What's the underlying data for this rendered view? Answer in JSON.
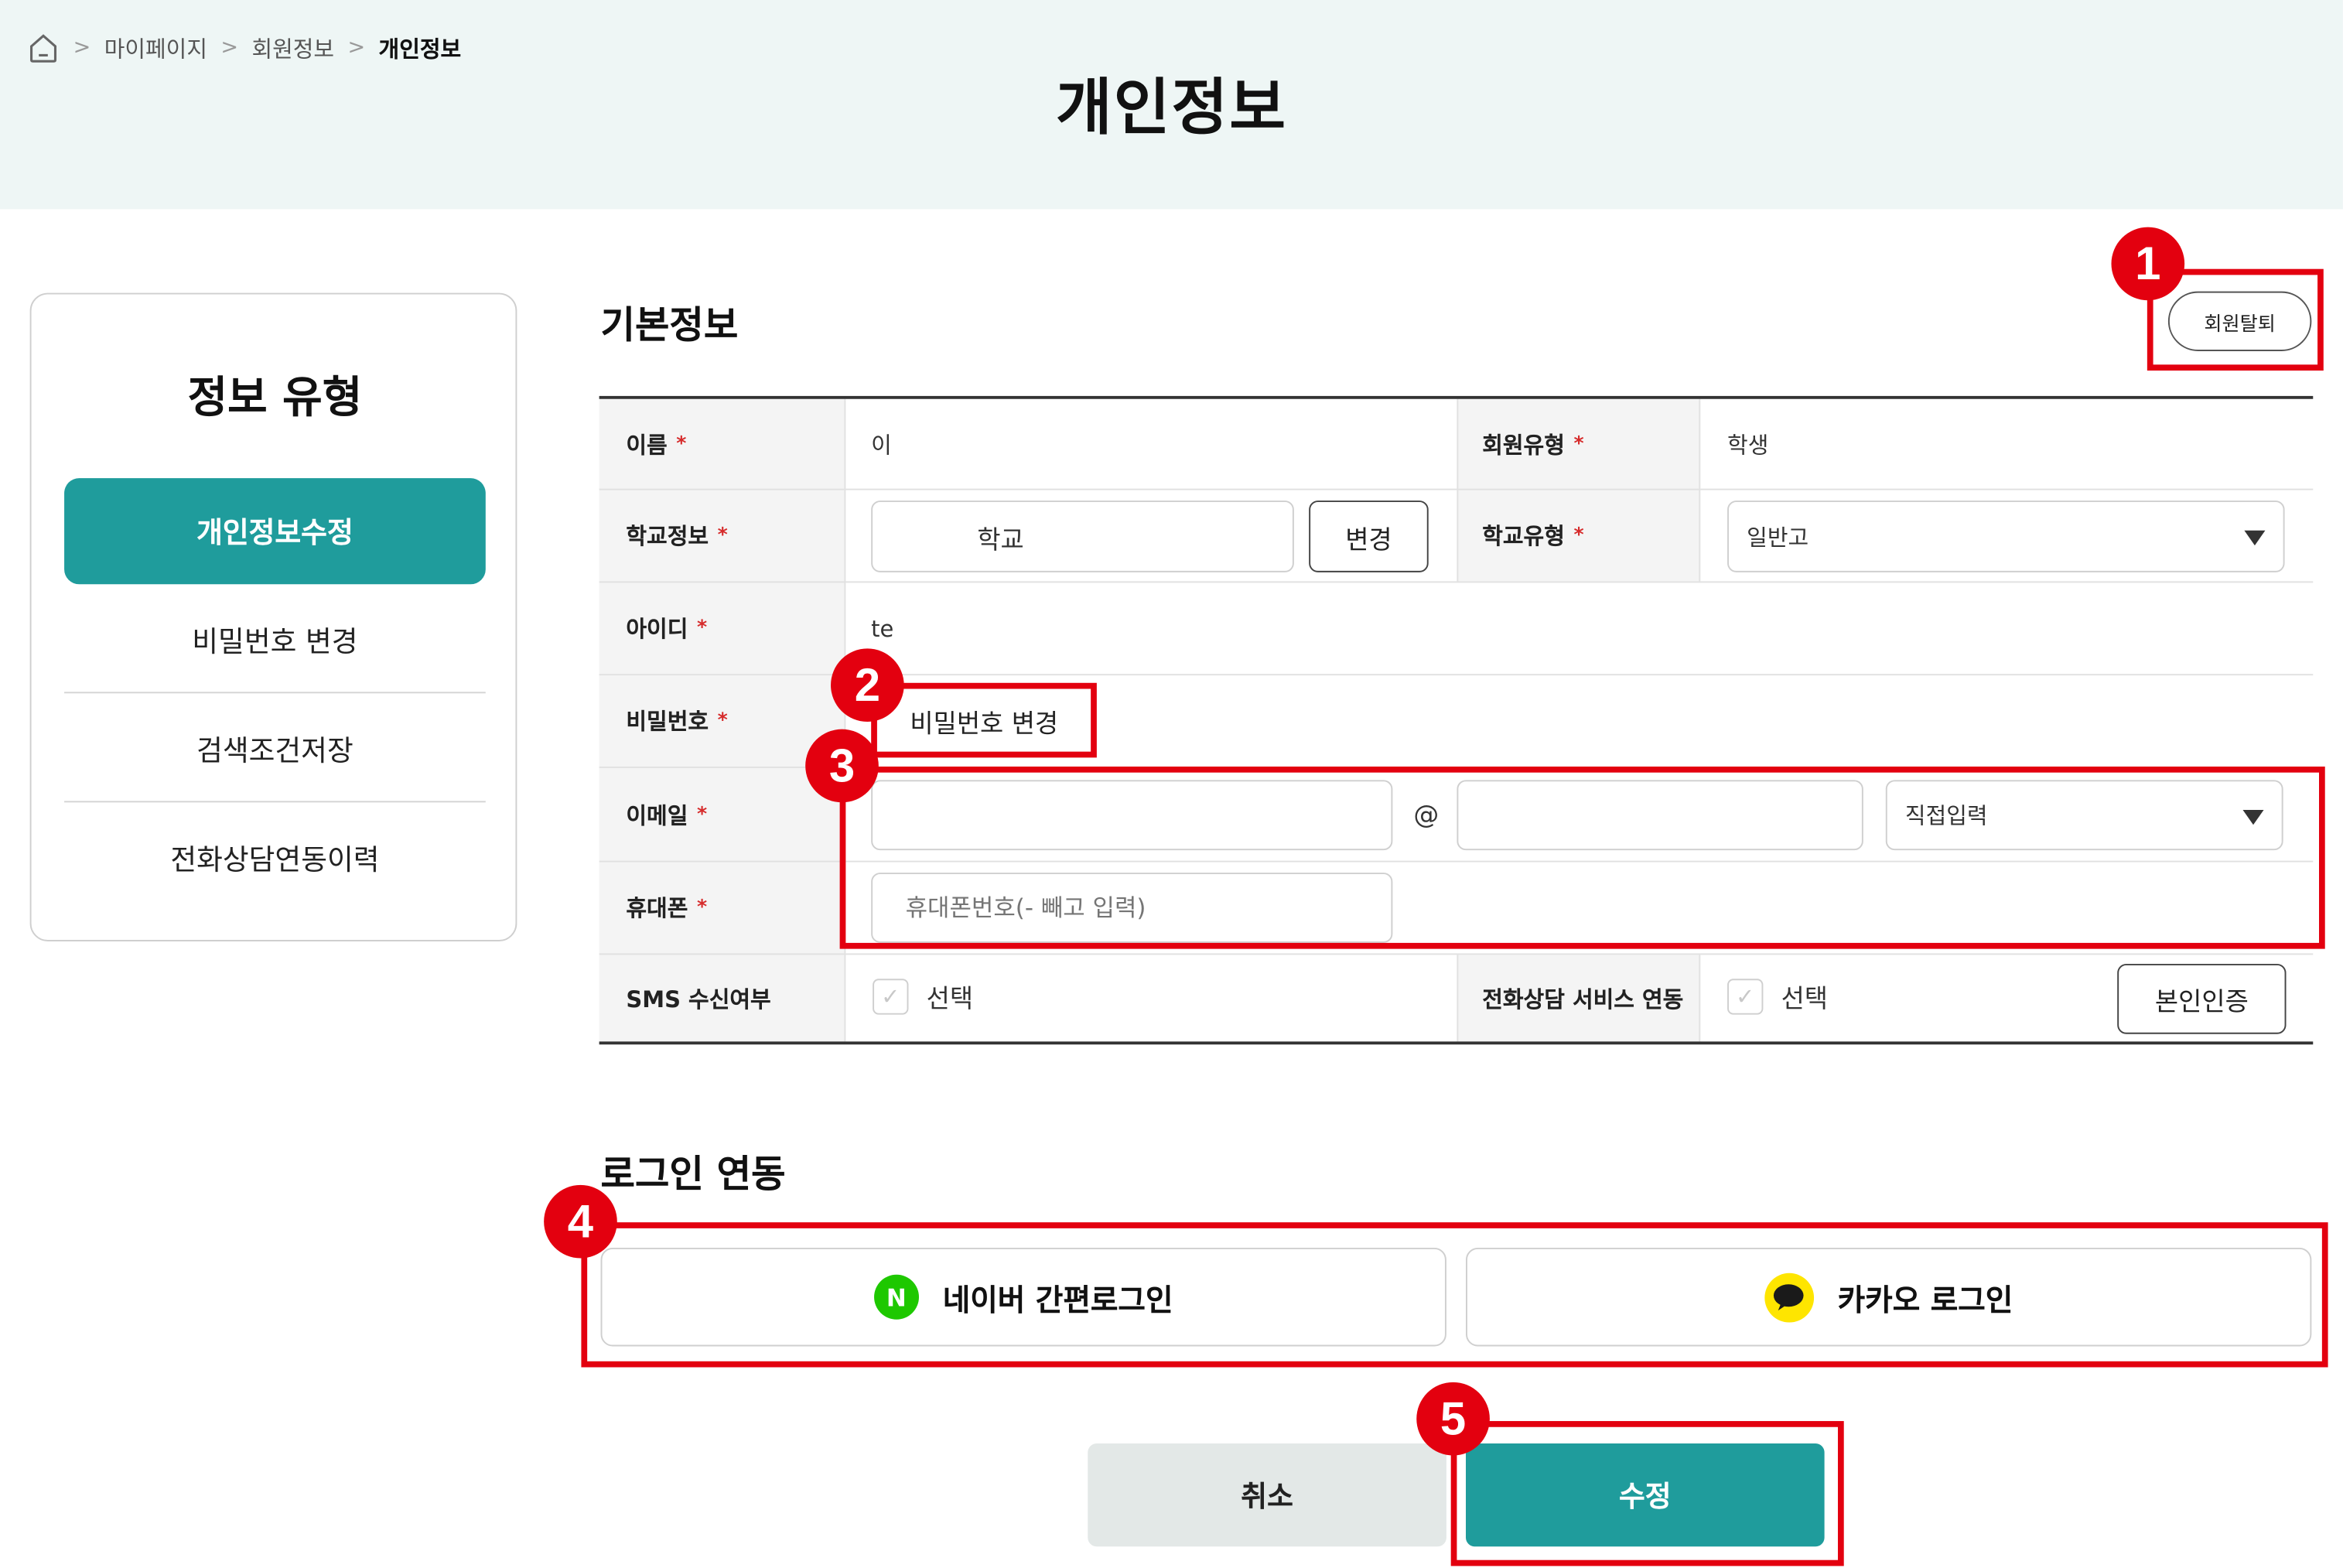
{
  "breadcrumb": {
    "home_icon": "home-icon",
    "items": [
      "마이페이지",
      "회원정보",
      "개인정보"
    ],
    "separator": ">"
  },
  "page_title": "개인정보",
  "sidebar": {
    "title": "정보 유형",
    "items": [
      {
        "label": "개인정보수정",
        "active": true
      },
      {
        "label": "비밀번호 변경",
        "active": false
      },
      {
        "label": "검색조건저장",
        "active": false
      },
      {
        "label": "전화상담연동이력",
        "active": false
      }
    ]
  },
  "basic_info": {
    "title": "기본정보",
    "withdraw_label": "회원탈퇴",
    "required_mark": "*",
    "fields": {
      "name": {
        "label": "이름",
        "value": "이"
      },
      "member_type": {
        "label": "회원유형",
        "value": "학생"
      },
      "school_info": {
        "label": "학교정보",
        "value": "학교",
        "change_label": "변경"
      },
      "school_type": {
        "label": "학교유형",
        "value": "일반고"
      },
      "user_id": {
        "label": "아이디",
        "value": "te"
      },
      "password": {
        "label": "비밀번호",
        "change_label": "비밀번호 변경"
      },
      "email": {
        "label": "이메일",
        "local": "",
        "at": "@",
        "domain": "",
        "domain_select": "직접입력"
      },
      "phone": {
        "label": "휴대폰",
        "value": "",
        "placeholder": "휴대폰번호(- 빼고 입력)"
      },
      "sms": {
        "label": "SMS 수신여부",
        "option": "선택",
        "checked": false
      },
      "phone_consult": {
        "label": "전화상담 서비스 연동",
        "option": "선택",
        "checked": false,
        "verify_label": "본인인증"
      }
    }
  },
  "login_link": {
    "title": "로그인 연동",
    "naver": {
      "icon": "naver-icon",
      "icon_letter": "N",
      "label": "네이버 간편로그인"
    },
    "kakao": {
      "icon": "kakao-icon",
      "label": "카카오 로그인"
    }
  },
  "actions": {
    "cancel_label": "취소",
    "submit_label": "수정"
  },
  "annotations": [
    "1",
    "2",
    "3",
    "4",
    "5"
  ],
  "colors": {
    "accent": "#1f9c9c",
    "header_bg": "#eef6f5",
    "annotation_red": "#e3000f",
    "naver_green": "#1ec800",
    "kakao_yellow": "#fee500",
    "required_red": "#d62a2a"
  }
}
